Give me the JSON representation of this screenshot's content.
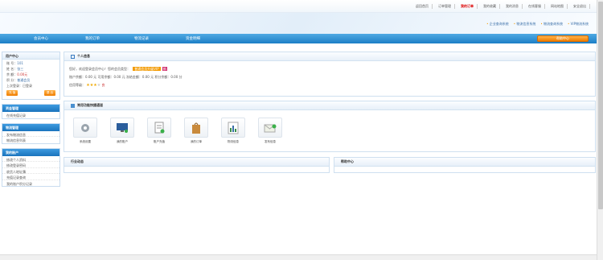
{
  "topbar": {
    "links": [
      "返回首页",
      "订单管理",
      "我的订单",
      "我的收藏",
      "我的消息",
      "在线客服",
      "网站地图",
      "安全退出"
    ],
    "hot_index": 2
  },
  "header": {
    "system_links": [
      "企业查询系统",
      "物流信息系统",
      "物流查询系统",
      "VIP物流系统"
    ]
  },
  "nav": {
    "items": [
      "会员中心",
      "我的订单",
      "物流记录",
      "资金明细"
    ],
    "help_button": "帮助中心"
  },
  "sidebar": {
    "user_center_title": "用户中心",
    "user_rows": [
      {
        "label": "账 号：",
        "value": "101"
      },
      {
        "label": "姓 名：",
        "value": "张三"
      },
      {
        "label": "余 额：",
        "value": "0.00元"
      },
      {
        "label": "积 分：",
        "value": "普通会员"
      },
      {
        "label": "上次登录：",
        "value": "已登录"
      }
    ],
    "btn_left": "充 值",
    "btn_right": "退 出",
    "sections": [
      {
        "title": "资金管理",
        "links": [
          "在线充值记录"
        ]
      },
      {
        "title": "物流管理",
        "links": [
          "发布物流信息",
          "物流信息列表"
        ]
      },
      {
        "title": "我的账户",
        "links": [
          "修改个人资料",
          "修改登录密码",
          "收货人地址簿",
          "充值记录查询",
          "我的账户积分记录"
        ]
      }
    ]
  },
  "personal": {
    "title": "个人信息",
    "line1": "您好，欢迎登录会员中心！您的会员类型：",
    "line1_badge": "普通会员升级VIP",
    "line1_tag": "新",
    "line2": "账户余额：0.00 元  可用余额：0.00 元  冻结金额：0.00 元  积分余额：0.00 分",
    "rating_label": "信用等级：",
    "stars": 3,
    "stars_total": 4,
    "rating_value": "良"
  },
  "apps": {
    "title": "常用功能快捷通道",
    "items": [
      {
        "label": "系统设置",
        "icon": "gear-icon"
      },
      {
        "label": "我的账户",
        "icon": "monitor-icon"
      },
      {
        "label": "账户充值",
        "icon": "document-icon"
      },
      {
        "label": "我的订单",
        "icon": "bag-icon"
      },
      {
        "label": "物流信息",
        "icon": "chart-icon"
      },
      {
        "label": "发布信息",
        "icon": "envelope-icon"
      }
    ]
  },
  "bottom": {
    "left_title": "行业动态",
    "right_title": "帮助中心"
  }
}
